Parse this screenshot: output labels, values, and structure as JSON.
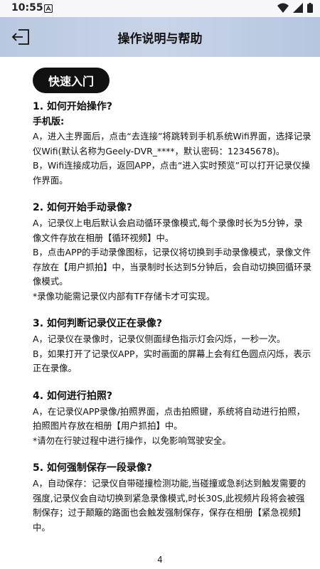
{
  "status": {
    "time": "10:55"
  },
  "header": {
    "title": "操作说明与帮助"
  },
  "section": "快速入门",
  "q1": {
    "title": "1. 如何开始操作?",
    "subtitle": "手机版:",
    "p1": "A，进入主界面后，点击“去连接”将跳转到手机系统Wifi界面，选择记录仪Wifi(默认名称为Geely-DVR_****，默认密码：12345678)。",
    "p2": "B，Wifi连接成功后，返回APP，点击“进入实时预览”可以打开记录仪操作界面。"
  },
  "q2": {
    "title": "2. 如何开始手动录像?",
    "p1": "A，记录仪上电后默认会启动循环录像模式,每个录像时长为5分钟，录像文件存放在相册【循环视频】中。",
    "p2": "B，点击APP的手动录像图标，记录仪将切换到手动录像模式，录像文件存放在【用户抓拍】中，当录制时长达到5分钟后，会自动切换回循环录像模式。",
    "p3": "*录像功能需记录仪内部有TF存储卡才可实现。"
  },
  "q3": {
    "title": "3. 如何判断记录仪正在录像?",
    "p1": "A，记录仪在录像时，记录仪侧面绿色指示灯会闪烁，一秒一次。",
    "p2": "B，如果打开了记录仪APP，实时画面的屏幕上会有红色圆点闪烁，表示正在录像。"
  },
  "q4": {
    "title": "4. 如何进行拍照?",
    "p1": "A，在记录仪APP录像/拍照界面，点击拍照键，系统将自动进行拍照，拍照图片存放在相册【用户抓拍】中。",
    "p2": "*请勿在行驶过程中进行操作，以免影响驾驶安全。"
  },
  "q5": {
    "title": "5. 如何强制保存一段录像?",
    "p1": "A，自动保存：记录仪自带碰撞检测功能,当碰撞或急刹达到触发需要的强度,记录仪会自动切换到紧急录像模式,时长30S,此视频片段将会被强制保存；过于颠簸的路面也会触发强制保存，保存在相册【紧急视频】中。"
  },
  "page_number": "4"
}
